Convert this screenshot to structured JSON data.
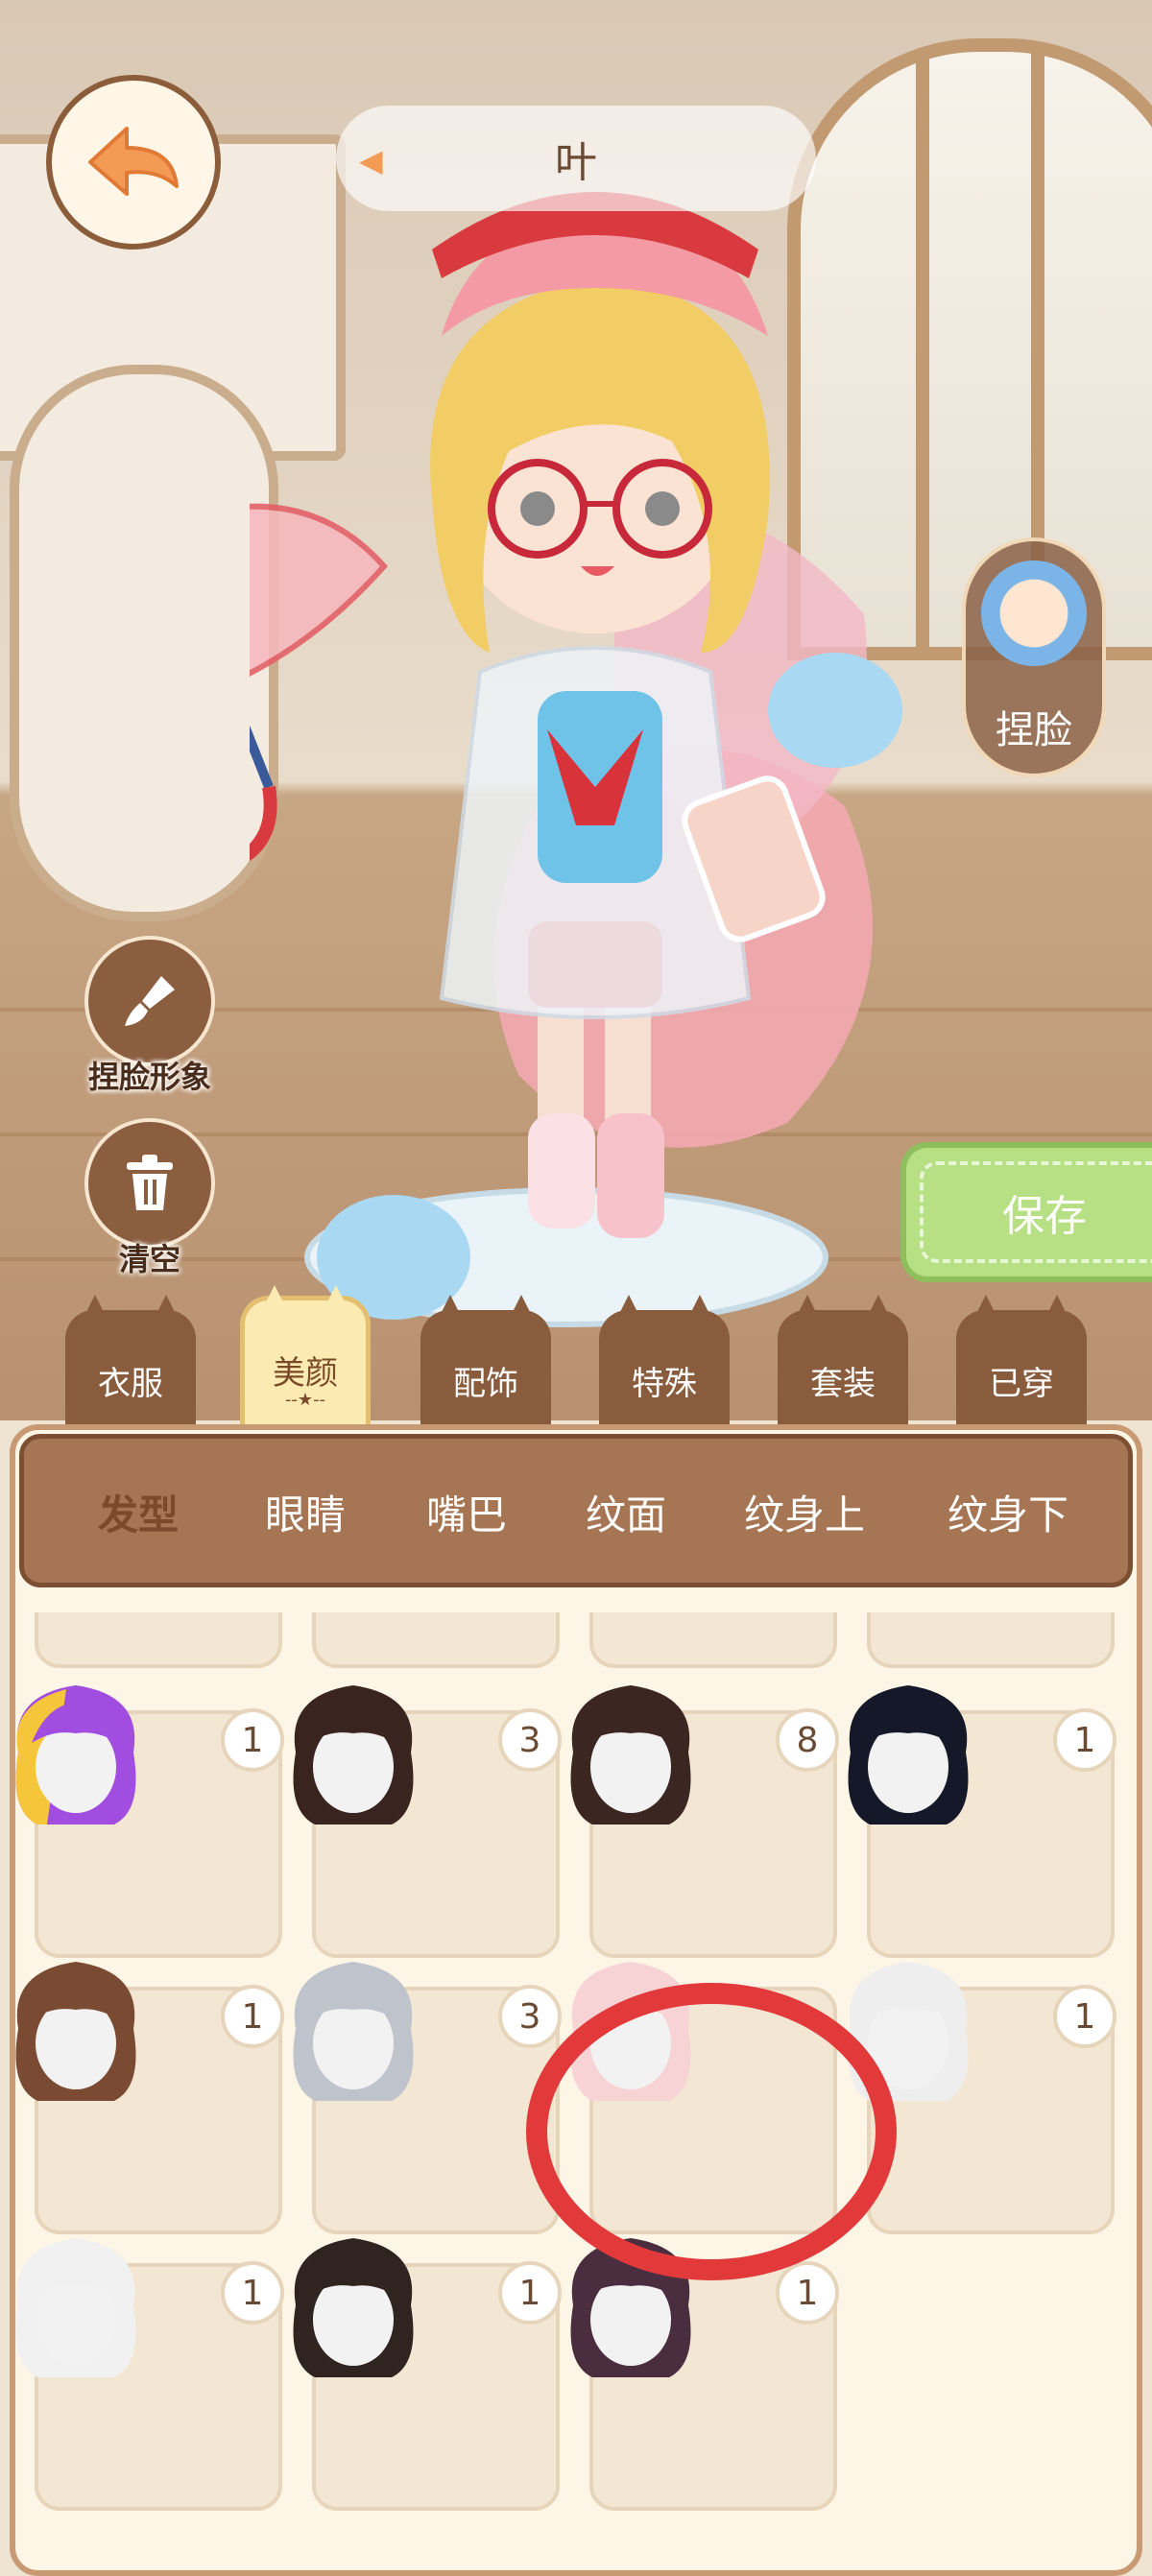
{
  "top_bar": {
    "name_text": "叶"
  },
  "right_button": {
    "label": "捏脸"
  },
  "left_buttons": [
    {
      "label": "捏脸形象"
    },
    {
      "label": "清空"
    }
  ],
  "save_button": {
    "label": "保存"
  },
  "category_tabs": [
    {
      "label": "衣服"
    },
    {
      "label": "美颜",
      "active": true,
      "decoration": "--★--"
    },
    {
      "label": "配饰"
    },
    {
      "label": "特殊"
    },
    {
      "label": "套装"
    },
    {
      "label": "已穿"
    }
  ],
  "sub_tabs": [
    {
      "label": "发型",
      "active": true
    },
    {
      "label": "眼睛"
    },
    {
      "label": "嘴巴"
    },
    {
      "label": "纹面"
    },
    {
      "label": "纹身上"
    },
    {
      "label": "纹身下"
    }
  ],
  "hair_items": [
    {
      "count": "1",
      "hair_color": "#a14de0",
      "accent": "#f5c53a"
    },
    {
      "count": "3",
      "hair_color": "#3a2420"
    },
    {
      "count": "8",
      "hair_color": "#3b2622"
    },
    {
      "count": "1",
      "hair_color": "#141828"
    },
    {
      "count": "1",
      "hair_color": "#7a4a32"
    },
    {
      "count": "3",
      "hair_color": "#bfc3cc"
    },
    {
      "count": "",
      "hair_color": "#f7d3d6",
      "highlighted": true
    },
    {
      "count": "1",
      "hair_color": "#eeeeee"
    },
    {
      "count": "1",
      "hair_color": "#f1f1f1"
    },
    {
      "count": "1",
      "hair_color": "#2f2420"
    },
    {
      "count": "1",
      "hair_color": "#4a2d3e"
    }
  ],
  "colors": {
    "brown": "#8a5c3e",
    "cream": "#fdf5e6",
    "save_green": "#b7df84",
    "highlight_red": "#e23a3a"
  }
}
